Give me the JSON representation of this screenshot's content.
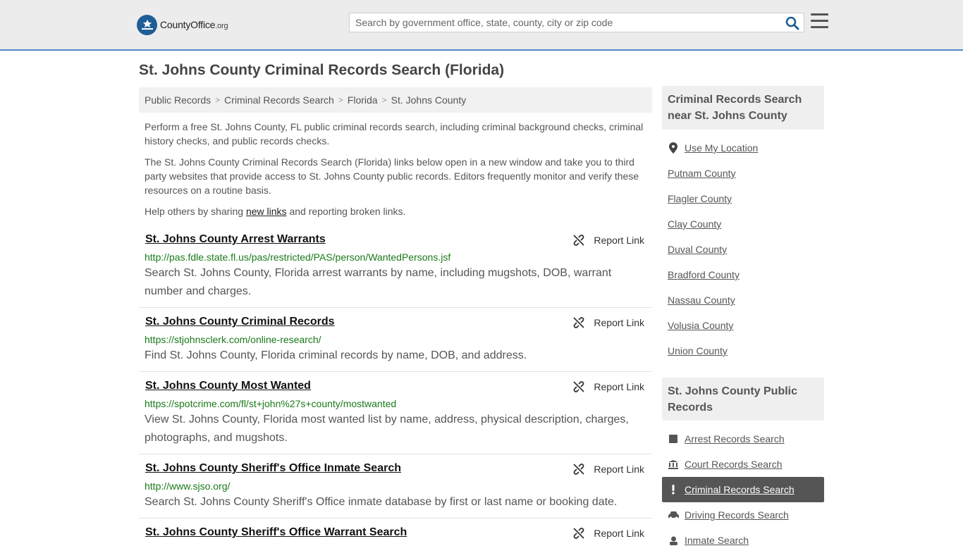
{
  "header": {
    "logo_text_main": "CountyOffice",
    "logo_text_org": ".org",
    "search_placeholder": "Search by government office, state, county, city or zip code"
  },
  "page_title": "St. Johns County Criminal Records Search (Florida)",
  "breadcrumb": [
    "Public Records",
    "Criminal Records Search",
    "Florida",
    "St. Johns County"
  ],
  "intro": {
    "p1": "Perform a free St. Johns County, FL public criminal records search, including criminal background checks, criminal history checks, and public records checks.",
    "p2": "The St. Johns County Criminal Records Search (Florida) links below open in a new window and take you to third party websites that provide access to St. Johns County public records. Editors frequently monitor and verify these resources on a routine basis.",
    "p3_before": "Help others by sharing ",
    "p3_link": "new links",
    "p3_after": " and reporting broken links."
  },
  "report_label": "Report Link",
  "results": [
    {
      "title": "St. Johns County Arrest Warrants",
      "url": "http://pas.fdle.state.fl.us/pas/restricted/PAS/person/WantedPersons.jsf",
      "desc": "Search St. Johns County, Florida arrest warrants by name, including mugshots, DOB, warrant number and charges."
    },
    {
      "title": "St. Johns County Criminal Records",
      "url": "https://stjohnsclerk.com/online-research/",
      "desc": "Find St. Johns County, Florida criminal records by name, DOB, and address."
    },
    {
      "title": "St. Johns County Most Wanted",
      "url": "https://spotcrime.com/fl/st+john%27s+county/mostwanted",
      "desc": "View St. Johns County, Florida most wanted list by name, address, physical description, charges, photographs, and mugshots."
    },
    {
      "title": "St. Johns County Sheriff's Office Inmate Search",
      "url": "http://www.sjso.org/",
      "desc": "Search St. Johns County Sheriff's Office inmate database by first or last name or booking date."
    },
    {
      "title": "St. Johns County Sheriff's Office Warrant Search",
      "url": "",
      "desc": ""
    }
  ],
  "sidebar": {
    "nearby_heading": "Criminal Records Search near St. Johns County",
    "use_location": "Use My Location",
    "nearby": [
      "Putnam County",
      "Flagler County",
      "Clay County",
      "Duval County",
      "Bradford County",
      "Nassau County",
      "Volusia County",
      "Union County"
    ],
    "public_heading": "St. Johns County Public Records",
    "public_links": [
      {
        "label": "Arrest Records Search",
        "icon": "square-icon"
      },
      {
        "label": "Court Records Search",
        "icon": "courthouse-icon"
      },
      {
        "label": "Criminal Records Search",
        "icon": "exclamation-icon",
        "active": true
      },
      {
        "label": "Driving Records Search",
        "icon": "car-icon"
      },
      {
        "label": "Inmate Search",
        "icon": "inmate-icon"
      }
    ]
  },
  "colors": {
    "accent_border": "#4f8ac6",
    "logo_blue": "#1f5d97",
    "url_green": "#1a7a1a",
    "active_bg": "#555555"
  }
}
